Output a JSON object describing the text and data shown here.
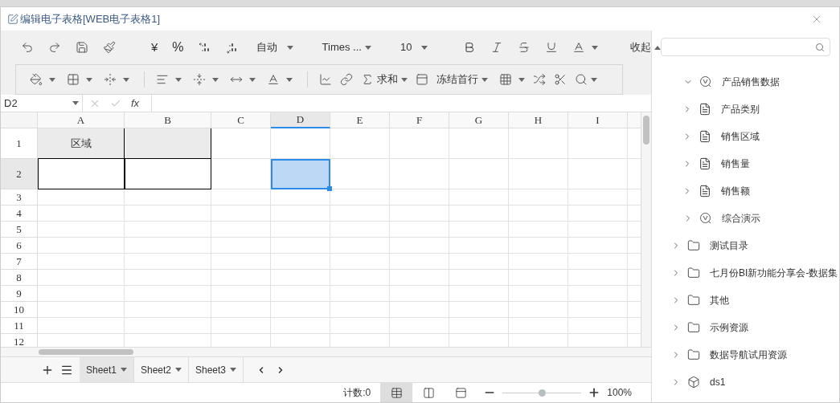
{
  "window": {
    "title": "编辑电子表格[WEB电子表格1]"
  },
  "toolbar": {
    "currency": "¥",
    "percent": "%",
    "format": "自动",
    "font": "Times ...",
    "size": "10",
    "collapse": "收起",
    "sum": "求和",
    "freeze": "冻结首行"
  },
  "formula_bar": {
    "cell_ref": "D2",
    "fx": "fx"
  },
  "table": {
    "columns": [
      {
        "label": "A",
        "selected": false
      },
      {
        "label": "B",
        "selected": false
      },
      {
        "label": "C",
        "selected": false
      },
      {
        "label": "D",
        "selected": true
      },
      {
        "label": "E",
        "selected": false
      },
      {
        "label": "F",
        "selected": false
      },
      {
        "label": "G",
        "selected": false
      },
      {
        "label": "H",
        "selected": false
      },
      {
        "label": "I",
        "selected": false
      }
    ],
    "rows": [
      {
        "label": "1",
        "selected": false,
        "cells": [
          {
            "kind": "shaded",
            "text": "区域",
            "selected": false
          },
          {
            "kind": "shaded",
            "selected": false
          },
          {
            "kind": "plain",
            "selected": false
          },
          {
            "kind": "plain",
            "selected": false
          }
        ]
      },
      {
        "label": "2",
        "selected": true,
        "cells": [
          {
            "kind": "bordered",
            "selected": false
          },
          {
            "kind": "bordered",
            "selected": false
          },
          {
            "kind": "plain",
            "selected": false
          },
          {
            "kind": "plain",
            "selected": true
          }
        ]
      },
      {
        "label": "3",
        "selected": false
      },
      {
        "label": "4",
        "selected": false
      },
      {
        "label": "5",
        "selected": false
      },
      {
        "label": "6",
        "selected": false
      },
      {
        "label": "7",
        "selected": false
      },
      {
        "label": "8",
        "selected": false
      },
      {
        "label": "9",
        "selected": false
      },
      {
        "label": "10",
        "selected": false
      },
      {
        "label": "11",
        "selected": false
      },
      {
        "label": "12",
        "selected": false
      }
    ]
  },
  "sheet_tabs": [
    {
      "label": "Sheet1",
      "selected": true
    },
    {
      "label": "Sheet2",
      "selected": false
    },
    {
      "label": "Sheet3",
      "selected": false
    }
  ],
  "status_bar": {
    "count": "计数:0",
    "views": [
      {
        "selected": true
      },
      {
        "selected": false
      },
      {
        "selected": false
      }
    ],
    "zoom": {
      "level": 0.5,
      "reading": "100%"
    }
  },
  "tree": [
    {
      "kind": "dataset",
      "label": "产品销售数据",
      "expanded": true,
      "children": [
        {
          "kind": "table",
          "label": "产品类别",
          "expanded": false
        },
        {
          "kind": "table",
          "label": "销售区域",
          "expanded": false
        },
        {
          "kind": "table",
          "label": "销售量",
          "expanded": false
        },
        {
          "kind": "table",
          "label": "销售额",
          "expanded": false
        }
      ]
    },
    {
      "kind": "dataset",
      "label": "综合演示",
      "expanded": false
    },
    {
      "kind": "folder",
      "label": "测试目录",
      "expanded": false
    },
    {
      "kind": "folder",
      "label": "七月份BI新功能分享会-数据集",
      "expanded": false
    },
    {
      "kind": "folder",
      "label": "其他",
      "expanded": false
    },
    {
      "kind": "folder",
      "label": "示例资源",
      "expanded": false
    },
    {
      "kind": "folder",
      "label": "数据导航试用资源",
      "expanded": false
    },
    {
      "kind": "cube",
      "label": "ds1",
      "expanded": false
    }
  ]
}
